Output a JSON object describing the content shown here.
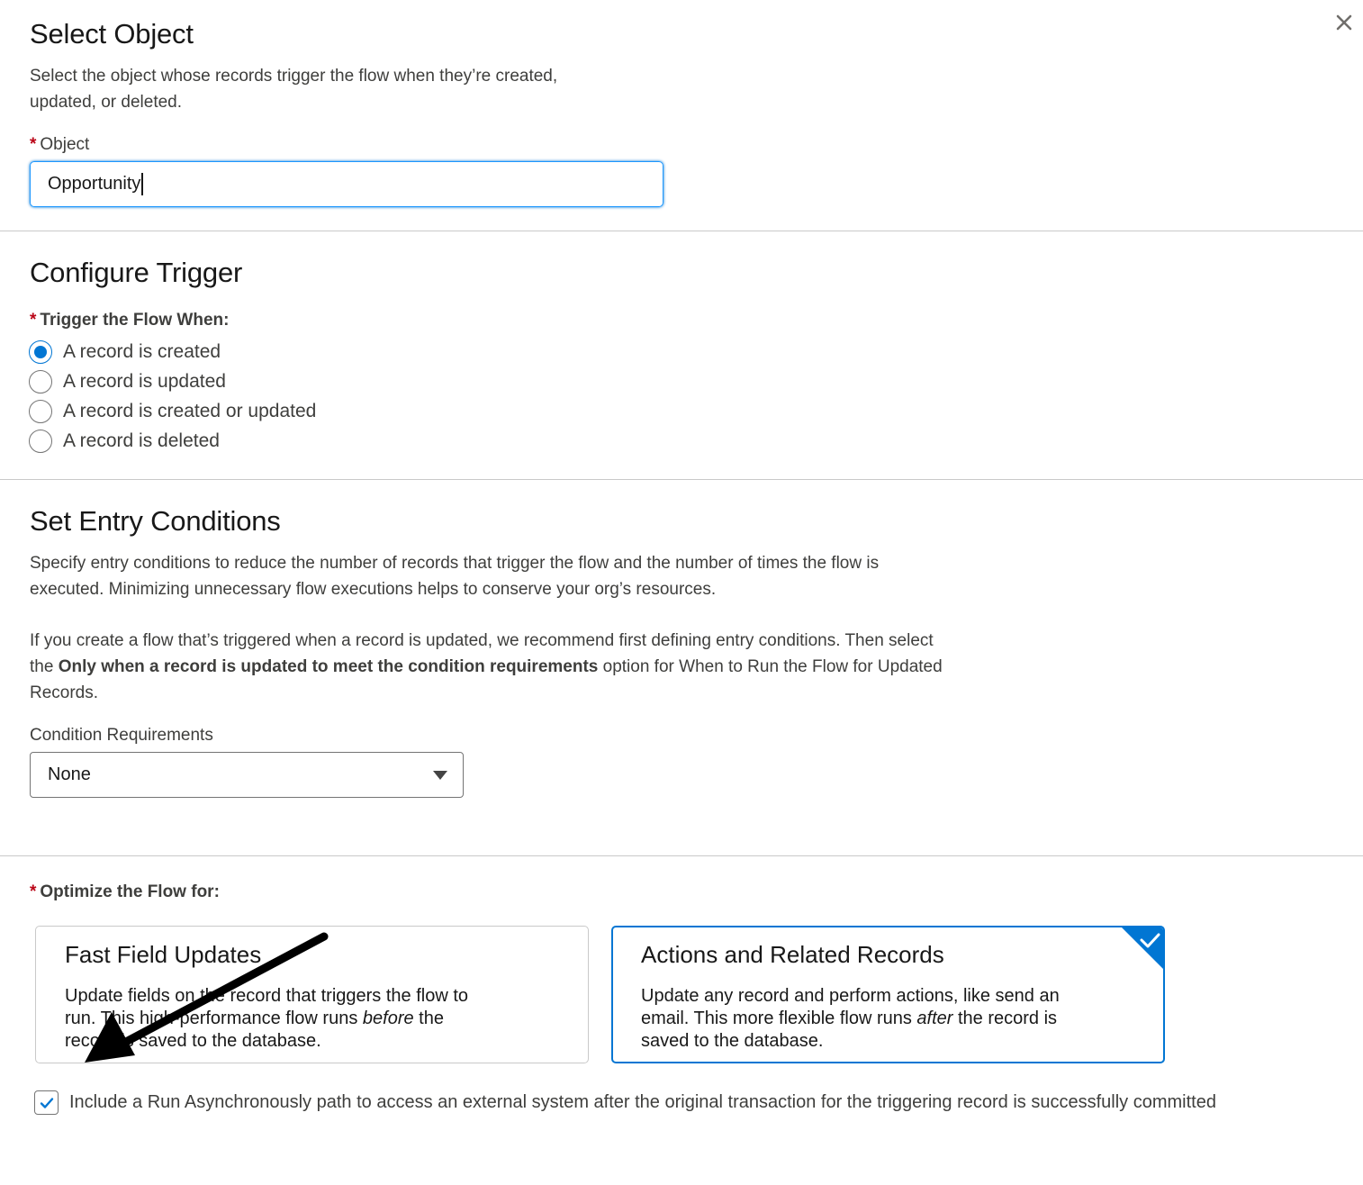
{
  "modal": {
    "close_icon": "close-icon"
  },
  "select_object": {
    "title": "Select Object",
    "description_line1": "Select the object whose records trigger the flow when they’re created,",
    "description_line2": "updated, or deleted.",
    "object_label": "Object",
    "required_marker": "*",
    "object_value": "Opportunity"
  },
  "configure_trigger": {
    "title": "Configure Trigger",
    "trigger_label": "Trigger the Flow When:",
    "required_marker": "*",
    "options": [
      {
        "label": "A record is created",
        "checked": true
      },
      {
        "label": "A record is updated",
        "checked": false
      },
      {
        "label": "A record is created or updated",
        "checked": false
      },
      {
        "label": "A record is deleted",
        "checked": false
      }
    ]
  },
  "entry_conditions": {
    "title": "Set Entry Conditions",
    "para1_line1": "Specify entry conditions to reduce the number of records that trigger the flow and the number of times the flow is",
    "para1_line2": "executed. Minimizing unnecessary flow executions helps to conserve your org’s resources.",
    "para2_line1": "If you create a flow that’s triggered when a record is updated, we recommend first defining entry conditions. Then select",
    "para2_line2_pre": "the ",
    "para2_line2_bold": "Only when a record is updated to meet the condition requirements",
    "para2_line2_post": " option for When to Run the Flow for Updated",
    "para2_line3": "Records.",
    "condition_label": "Condition Requirements",
    "condition_value": "None"
  },
  "optimize": {
    "label": "Optimize the Flow for:",
    "required_marker": "*",
    "cards": [
      {
        "title": "Fast Field Updates",
        "body_line1": "Update fields on the record that triggers the flow to",
        "body_line2_pre": "run. This high-performance flow runs ",
        "body_line2_em": "before",
        "body_line2_post": " the",
        "body_line3": "record is saved to the database.",
        "selected": false
      },
      {
        "title": "Actions and Related Records",
        "body_line1": "Update any record and perform actions, like send an",
        "body_line2_pre": "email. This more flexible flow runs ",
        "body_line2_em": "after",
        "body_line2_post": " the record is",
        "body_line3": "saved to the database.",
        "selected": true
      }
    ],
    "async_checkbox_label": "Include a Run Asynchronously path to access an external system after the original transaction for the triggering record is successfully committed",
    "async_checked": true
  },
  "colors": {
    "brand": "#0176d3",
    "required": "#ba0517",
    "annotation_arrow": "#000000"
  }
}
